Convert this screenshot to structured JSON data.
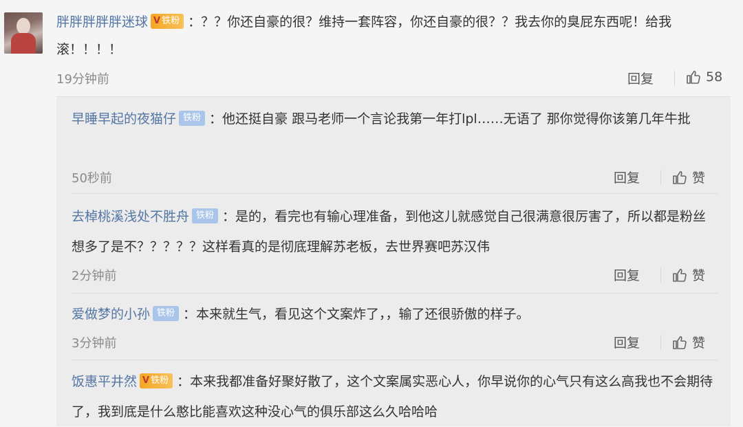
{
  "top_comment": {
    "username": "胖胖胖胖胖迷球",
    "badge": {
      "vip": "V",
      "text": "铁粉"
    },
    "text": "：？？你还自豪的很？维持一套阵容，你还自豪的很？？我去你的臭屁东西呢！给我滚！！！！",
    "time": "19分钟前",
    "reply_label": "回复",
    "like_count": "58"
  },
  "replies": [
    {
      "username": "早睡早起的夜猫仔",
      "badge": {
        "type": "blue",
        "text": "铁粉"
      },
      "text": "：他还挺自豪 跟马老师一个言论我第一年打lpl……无语了 那你觉得你该第几年牛批",
      "time": "50秒前",
      "reply_label": "回复",
      "like_label": "赞"
    },
    {
      "username": "去棹桃溪浅处不胜舟",
      "badge": {
        "type": "blue",
        "text": "铁粉"
      },
      "text": "：是的，看完也有输心理准备，到他这儿就感觉自己很满意很厉害了，所以都是粉丝想多了是不？？？？？这样看真的是彻底理解苏老板，去世界赛吧苏汉伟",
      "time": "2分钟前",
      "reply_label": "回复",
      "like_label": "赞"
    },
    {
      "username": "爱做梦的小孙",
      "badge": {
        "type": "blue",
        "text": "铁粉"
      },
      "text": "：本来就生气，看见这个文案炸了，，输了还很骄傲的样子。",
      "time": "3分钟前",
      "reply_label": "回复",
      "like_label": "赞"
    },
    {
      "username": "饭惠平井然",
      "badge": {
        "type": "gold",
        "vip": "V",
        "text": "铁粉"
      },
      "text": "：本来我都准备好聚好散了，这个文案属实恶心人，你早说你的心气只有这么高我也不会期待了，我到底是什么憨比能喜欢这种没心气的俱乐部这么久哈哈哈"
    }
  ],
  "colors": {
    "username": "#5476a4",
    "badge_gold": "#f5a623",
    "badge_blue": "#a9c6ea",
    "meta": "#8a8a8a"
  },
  "icons": {
    "like": "thumbs-up-icon"
  }
}
